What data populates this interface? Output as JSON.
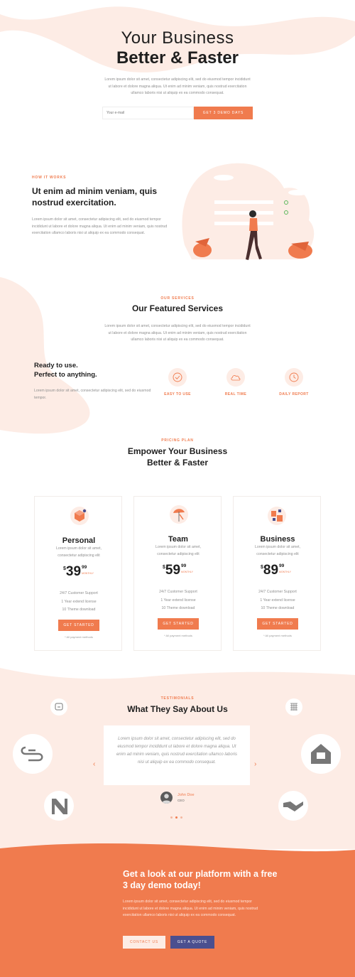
{
  "colors": {
    "accent": "#f07b4e",
    "peach": "#fdece5",
    "navy": "#4b4f8f",
    "dark": "#1e1e1e"
  },
  "hero": {
    "title_line1": "Your Business",
    "title_line2": "Better & Faster",
    "text": "Lorem ipsum dolor sit amet, consectetur adipiscing elit, sed do eiusmod tempor incididunt ut labore et dolore magna aliqua. Ut enim ad minim veniam, quis nostrud exercitation ullamco laboris nisi ut aliquip ex ea commodo consequat.",
    "email_placeholder": "Your e-mail",
    "cta": "GET 3 DEMO DAYS"
  },
  "how": {
    "eyebrow": "HOW IT WORKS",
    "title": "Ut enim ad minim veniam, quis nostrud exercitation.",
    "text": "Lorem ipsum dolor sit amet, consectetur adipiscing elit, sed do eiusmod tempor incididunt ut labore et dolore magna aliqua. Ut enim ad minim veniam, quis nostrud exercitation ullamco laboris nisi ut aliquip ex ea commodo consequat."
  },
  "services": {
    "eyebrow": "OUR SERVICES",
    "title": "Our Featured Services",
    "text": "Lorem ipsum dolor sit amet, consectetur adipiscing elit, sed do eiusmod tempor incididunt ut labore et dolore magna aliqua. Ut enim ad minim veniam, quis nostrud exercitation ullamco laboris nisi ut aliquip ex ea commodo consequat.",
    "ready_line1": "Ready to use.",
    "ready_line2": "Perfect to anything.",
    "ready_text": "Lorem ipsum dolor sit amet, consectetur adipiscing elit, sed do eiusmod tempor.",
    "features": [
      {
        "label": "EASY TO USE",
        "icon": "check-circle-icon"
      },
      {
        "label": "REAL TIME",
        "icon": "cloud-icon"
      },
      {
        "label": "DAILY REPORT",
        "icon": "clock-icon"
      }
    ]
  },
  "pricing": {
    "eyebrow": "PRICING PLAN",
    "title_line1": "Empower Your Business",
    "title_line2": "Better & Faster",
    "plans": [
      {
        "name": "Personal",
        "desc": "Lorem ipsum dolor sit amet, consectetur adipiscing elit",
        "currency": "$",
        "price": "39",
        "cents": "99",
        "period": "MONTHLY",
        "features": [
          "24/7 Customer Support",
          "1 Year extend license",
          "10 Theme download"
        ],
        "cta": "GET STARTED",
        "note": "* All payment methods"
      },
      {
        "name": "Team",
        "desc": "Lorem ipsum dolor sit amet, consectetur adipiscing elit",
        "currency": "$",
        "price": "59",
        "cents": "99",
        "period": "MONTHLY",
        "features": [
          "24/7 Customer Support",
          "1 Year extend license",
          "10 Theme download"
        ],
        "cta": "GET STARTED",
        "note": "* All payment methods"
      },
      {
        "name": "Business",
        "desc": "Lorem ipsum dolor sit amet, consectetur adipiscing elit",
        "currency": "$",
        "price": "89",
        "cents": "99",
        "period": "MONTHLY",
        "features": [
          "24/7 Customer Support",
          "1 Year extend license",
          "10 Theme download"
        ],
        "cta": "GET STARTED",
        "note": "* All payment methods"
      }
    ]
  },
  "testimonials": {
    "eyebrow": "TESTIMONIALS",
    "title": "What They Say About Us",
    "quote": "Lorem ipsum dolor sit amet, consectetur adipiscing elit, sed do eiusmod tempor incididunt ut labore et dolore magna aliqua. Ut enim ad minim veniam, quis nostrud exercitation ullamco laboris nisi ut aliquip ex ea commodo consequat.",
    "author": "John Doe",
    "role": "CEO",
    "prev": "‹",
    "next": "›"
  },
  "cta_section": {
    "title_line1": "Get a look at our platform with a free",
    "title_line2": "3 day demo today!",
    "text": "Lorem ipsum dolor sit amet, consectetur adipiscing elit, sed do eiusmod tempor incididunt ut labore et dolore magna aliqua. Ut enim ad minim veniam, quis nostrud exercitation ullamco laboris nisi ut aliquip ex ea commodo consequat.",
    "contact": "CONTACT US",
    "quote_btn": "GET A QUOTE"
  }
}
